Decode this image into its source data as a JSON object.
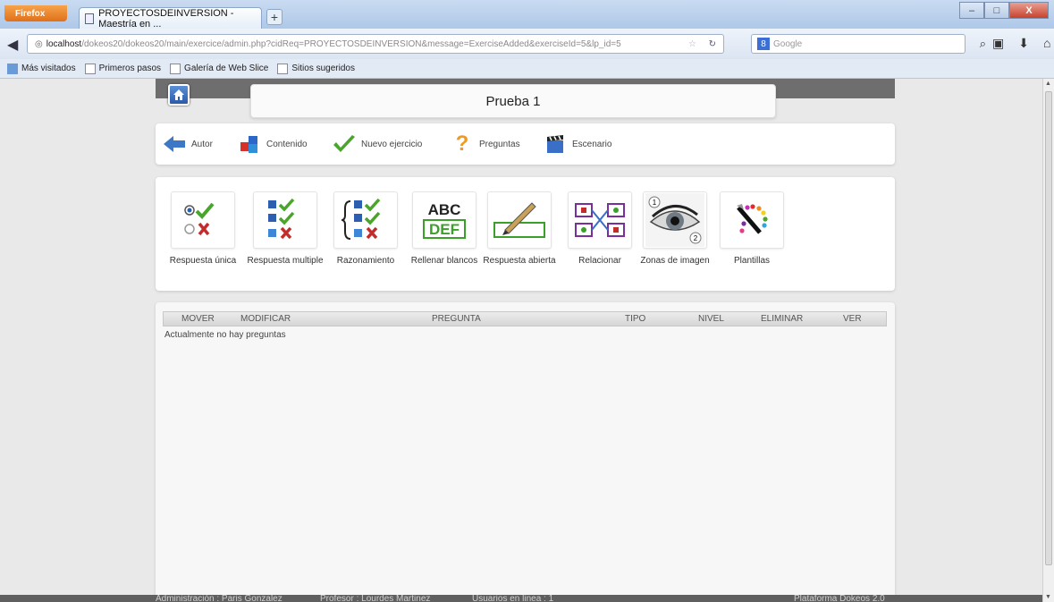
{
  "browser": {
    "app_button": "Firefox",
    "tab_title": "PROYECTOSDEINVERSION - Maestría en ...",
    "url_host": "localhost",
    "url_path": "/dokeos20/dokeos20/main/exercice/admin.php?cidReq=PROYECTOSDEINVERSION&message=ExerciseAdded&exerciseId=5&lp_id=5",
    "search_placeholder": "Google",
    "bookmarks": [
      "Más visitados",
      "Primeros pasos",
      "Galería de Web Slice",
      "Sitios sugeridos"
    ]
  },
  "page": {
    "title": "Prueba 1",
    "toolbar": [
      {
        "label": "Autor",
        "icon": "arrow-left-icon"
      },
      {
        "label": "Contenido",
        "icon": "blocks-icon"
      },
      {
        "label": "Nuevo ejercicio",
        "icon": "checkmark-icon"
      },
      {
        "label": "Preguntas",
        "icon": "question-mark-icon"
      },
      {
        "label": "Escenario",
        "icon": "clapperboard-icon"
      }
    ],
    "question_types": [
      {
        "label": "Respuesta única",
        "icon": "radio-check-icon"
      },
      {
        "label": "Respuesta multiple",
        "icon": "checkbox-check-icon"
      },
      {
        "label": "Razonamiento",
        "icon": "brace-checkbox-icon"
      },
      {
        "label": "Rellenar blancos",
        "icon": "abc-def-icon"
      },
      {
        "label": "Respuesta abierta",
        "icon": "pencil-icon"
      },
      {
        "label": "Relacionar",
        "icon": "matching-icon"
      },
      {
        "label": "Zonas de imagen",
        "icon": "eye-icon"
      },
      {
        "label": "Plantillas",
        "icon": "palette-icon"
      }
    ],
    "table": {
      "columns": [
        "MOVER",
        "MODIFICAR",
        "PREGUNTA",
        "TIPO",
        "NIVEL",
        "ELIMINAR",
        "VER"
      ],
      "empty_message": "Actualmente no hay preguntas"
    },
    "footer": {
      "admin": "Administración : Paris Gonzalez",
      "teacher": "Profesor : Lourdes Martinez",
      "online": "Usuarios en linea : 1",
      "platform": "Plataforma Dokeos 2.0"
    }
  }
}
